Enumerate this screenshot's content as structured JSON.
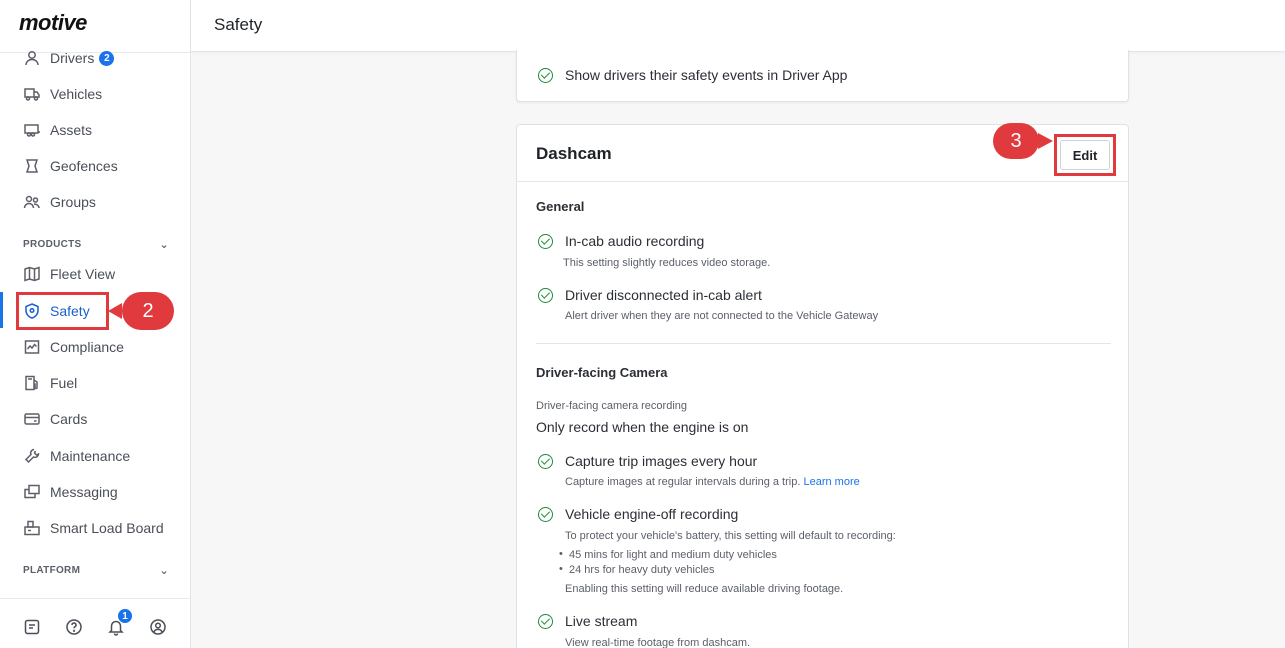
{
  "app": {
    "logo": "motive"
  },
  "header": {
    "title": "Safety"
  },
  "sidebar": {
    "items": [
      {
        "label": "Drivers",
        "badge": "2"
      },
      {
        "label": "Vehicles"
      },
      {
        "label": "Assets"
      },
      {
        "label": "Geofences"
      },
      {
        "label": "Groups"
      }
    ],
    "products_label": "PRODUCTS",
    "products": [
      {
        "label": "Fleet View"
      },
      {
        "label": "Safety"
      },
      {
        "label": "Compliance"
      },
      {
        "label": "Fuel"
      },
      {
        "label": "Cards"
      },
      {
        "label": "Maintenance"
      },
      {
        "label": "Messaging"
      },
      {
        "label": "Smart Load Board"
      }
    ],
    "platform_label": "PLATFORM",
    "notification_count": "1"
  },
  "callouts": {
    "step2": "2",
    "step3": "3"
  },
  "top_card": {
    "row": "Show drivers their safety events in Driver App"
  },
  "dashcam": {
    "title": "Dashcam",
    "edit_label": "Edit",
    "general_title": "General",
    "audio_label": "In-cab audio recording",
    "audio_sub": "This setting slightly reduces video storage.",
    "disconnected_label": "Driver disconnected in-cab alert",
    "disconnected_sub": "Alert driver when they are not connected to the Vehicle Gateway",
    "dfc_title": "Driver-facing Camera",
    "dfc_recording_label": "Driver-facing camera recording",
    "dfc_recording_value": "Only record when the engine is on",
    "trip_images_label": "Capture trip images every hour",
    "trip_images_sub": "Capture images at regular intervals during a trip.",
    "learn_more": "Learn more",
    "engine_off_label": "Vehicle engine-off recording",
    "engine_off_sub": "To protect your vehicle's battery, this setting will default to recording:",
    "engine_off_bullet1": "45 mins for light and medium duty vehicles",
    "engine_off_bullet2": "24 hrs for heavy duty vehicles",
    "engine_off_note": "Enabling this setting will reduce available driving footage.",
    "live_stream_label": "Live stream",
    "live_stream_sub": "View real-time footage from dashcam."
  }
}
